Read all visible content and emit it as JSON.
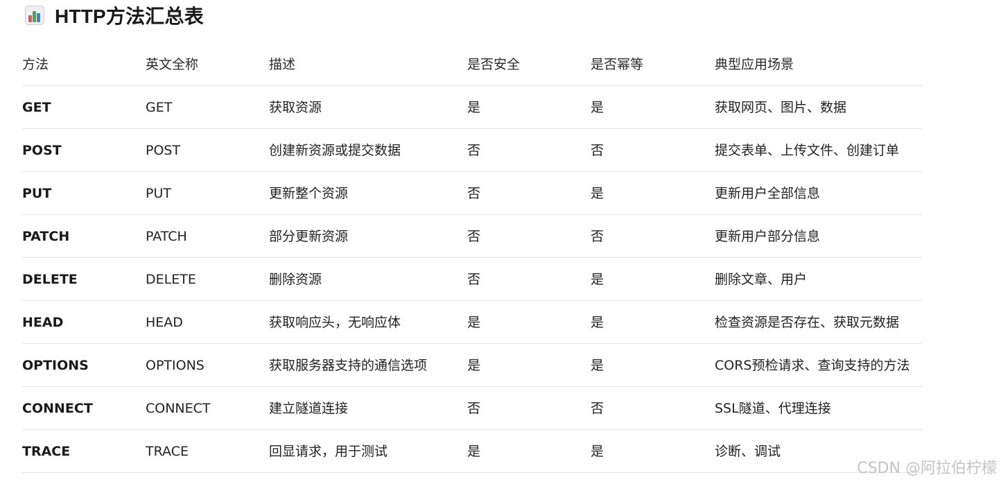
{
  "header": {
    "icon": "bar-chart-icon",
    "title": "HTTP方法汇总表"
  },
  "colors": {
    "bar_1": "#e05a4f",
    "bar_2": "#3cae5b",
    "bar_3": "#4a7fd6",
    "bar_4": "#e6a22d"
  },
  "table": {
    "columns": [
      "方法",
      "英文全称",
      "描述",
      "是否安全",
      "是否幂等",
      "典型应用场景"
    ],
    "rows": [
      [
        "GET",
        "GET",
        "获取资源",
        "是",
        "是",
        "获取网页、图片、数据"
      ],
      [
        "POST",
        "POST",
        "创建新资源或提交数据",
        "否",
        "否",
        "提交表单、上传文件、创建订单"
      ],
      [
        "PUT",
        "PUT",
        "更新整个资源",
        "否",
        "是",
        "更新用户全部信息"
      ],
      [
        "PATCH",
        "PATCH",
        "部分更新资源",
        "否",
        "否",
        "更新用户部分信息"
      ],
      [
        "DELETE",
        "DELETE",
        "删除资源",
        "否",
        "是",
        "删除文章、用户"
      ],
      [
        "HEAD",
        "HEAD",
        "获取响应头，无响应体",
        "是",
        "是",
        "检查资源是否存在、获取元数据"
      ],
      [
        "OPTIONS",
        "OPTIONS",
        "获取服务器支持的通信选项",
        "是",
        "是",
        "CORS预检请求、查询支持的方法"
      ],
      [
        "CONNECT",
        "CONNECT",
        "建立隧道连接",
        "否",
        "否",
        "SSL隧道、代理连接"
      ],
      [
        "TRACE",
        "TRACE",
        "回显请求，用于测试",
        "是",
        "是",
        "诊断、调试"
      ]
    ]
  },
  "watermark": "CSDN @阿拉伯柠檬"
}
